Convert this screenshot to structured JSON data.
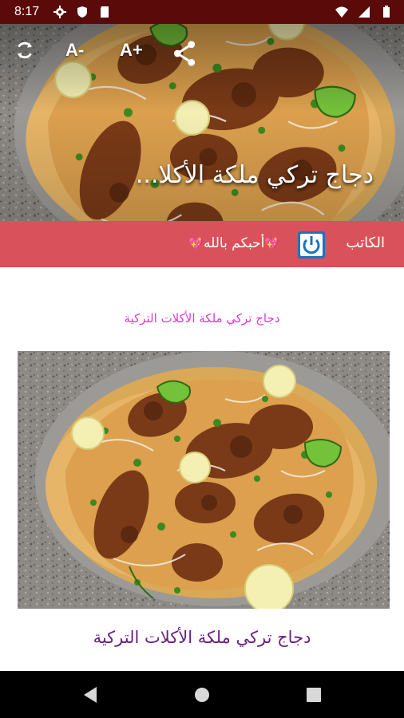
{
  "status_bar": {
    "time": "8:17",
    "icons_left": [
      "gear-icon",
      "shield-icon",
      "sd-card-icon"
    ],
    "icons_right": [
      "wifi-icon",
      "signal-icon",
      "battery-icon"
    ]
  },
  "hero": {
    "title": "دجاج تركي ملكة الأكلا...",
    "tools": {
      "refresh_icon": "refresh-icon",
      "decrease_font_label": "A-",
      "increase_font_label": "A+",
      "share_icon": "share-icon"
    }
  },
  "author_bar": {
    "label": "الكاتب",
    "name": "أحبكم بالله",
    "power_icon": "power-icon",
    "colors": {
      "background": "#d9515b",
      "button": "#1e73be"
    }
  },
  "article": {
    "subtitle": "دجاج تركي ملكة الأكلات التركية",
    "caption": "دجاج تركي ملكة الأكلات التركية",
    "colors": {
      "subtitle": "#e236d6",
      "caption": "#6a1f86"
    }
  },
  "nav_bar": {
    "icons": [
      "back-icon",
      "home-icon",
      "recents-icon"
    ]
  }
}
